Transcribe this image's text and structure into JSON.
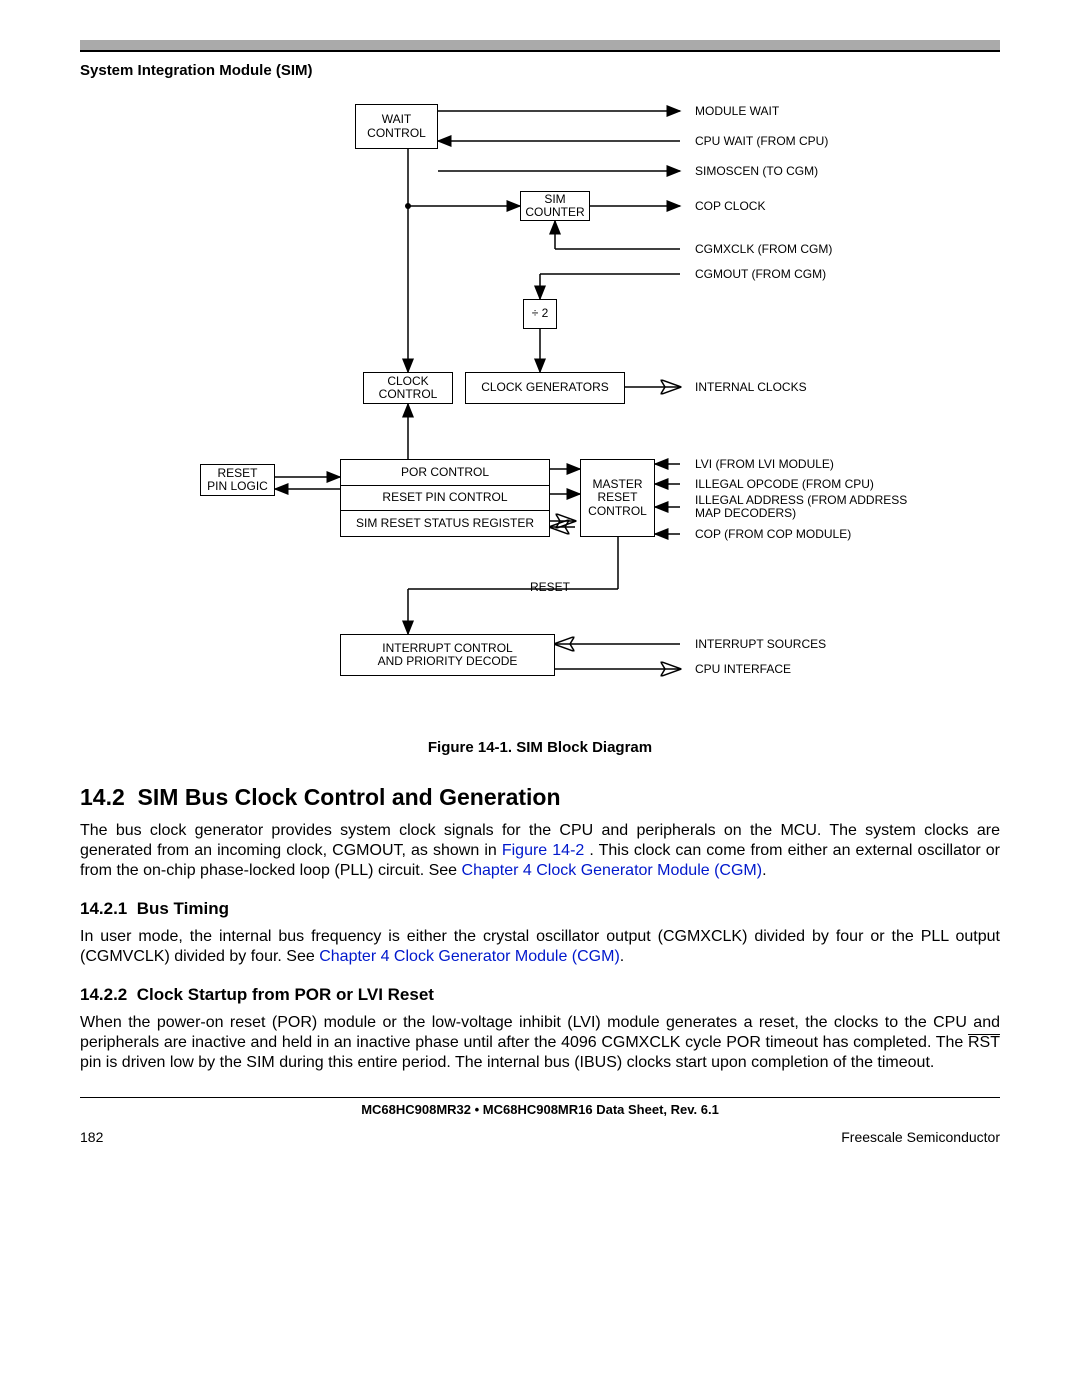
{
  "header": {
    "section": "System Integration Module (SIM)"
  },
  "diagram": {
    "boxes": {
      "wait_control": "WAIT\nCONTROL",
      "sim_counter": "SIM\nCOUNTER",
      "div2": "÷ 2",
      "clock_control": "CLOCK\nCONTROL",
      "clock_generators": "CLOCK GENERATORS",
      "reset_pin_logic": "RESET\nPIN LOGIC",
      "por_control": "POR CONTROL",
      "reset_pin_control": "RESET PIN CONTROL",
      "sim_reset_status_register": "SIM RESET STATUS REGISTER",
      "master_reset_control": "MASTER\nRESET\nCONTROL",
      "interrupt_control": "INTERRUPT CONTROL\nAND PRIORITY DECODE"
    },
    "signals": {
      "module_wait": "MODULE WAIT",
      "cpu_wait": "CPU WAIT (FROM CPU)",
      "simoscen": "SIMOSCEN (TO CGM)",
      "cop_clock": "COP CLOCK",
      "cgmxclk": "CGMXCLK (FROM CGM)",
      "cgmout": "CGMOUT (FROM CGM)",
      "internal_clocks": "INTERNAL CLOCKS",
      "lvi": "LVI (FROM LVI MODULE)",
      "illegal_opcode": "ILLEGAL OPCODE (FROM CPU)",
      "illegal_address": "ILLEGAL ADDRESS (FROM ADDRESS\nMAP DECODERS)",
      "cop": "COP (FROM COP MODULE)",
      "reset": "RESET",
      "interrupt_sources": "INTERRUPT SOURCES",
      "cpu_interface": "CPU INTERFACE"
    },
    "caption": "Figure 14-1. SIM Block Diagram"
  },
  "section": {
    "number": "14.2",
    "title": "SIM Bus Clock Control and Generation",
    "para1_a": "The bus clock generator provides system clock signals for the CPU and peripherals on the MCU. The system clocks are generated from an incoming clock, CGMOUT, as shown in ",
    "para1_link1": "Figure 14-2",
    "para1_b": ". This clock can come from either an external oscillator or from the on-chip phase-locked loop (PLL) circuit. See ",
    "para1_link2": "Chapter 4 Clock Generator Module (CGM)",
    "para1_c": "."
  },
  "sub1": {
    "number": "14.2.1",
    "title": "Bus Timing",
    "para_a": "In user mode, the internal bus frequency is either the crystal oscillator output (CGMXCLK) divided by four or the PLL output (CGMVCLK) divided by four. See ",
    "para_link": "Chapter 4 Clock Generator Module (CGM)",
    "para_b": "."
  },
  "sub2": {
    "number": "14.2.2",
    "title": "Clock Startup from POR or LVI Reset",
    "para_a": "When the power-on reset (POR) module or the low-voltage inhibit (LVI) module generates a reset, the clocks to the CPU and peripherals are inactive and held in an inactive phase until after the 4096 CGMXCLK cycle POR timeout has completed. The ",
    "rst": "RST",
    "para_b": " pin is driven low by the SIM during this entire period. The internal bus (IBUS) clocks start upon completion of the timeout."
  },
  "footer": {
    "doc": "MC68HC908MR32 • MC68HC908MR16 Data Sheet, Rev. 6.1",
    "page": "182",
    "company": "Freescale Semiconductor"
  }
}
